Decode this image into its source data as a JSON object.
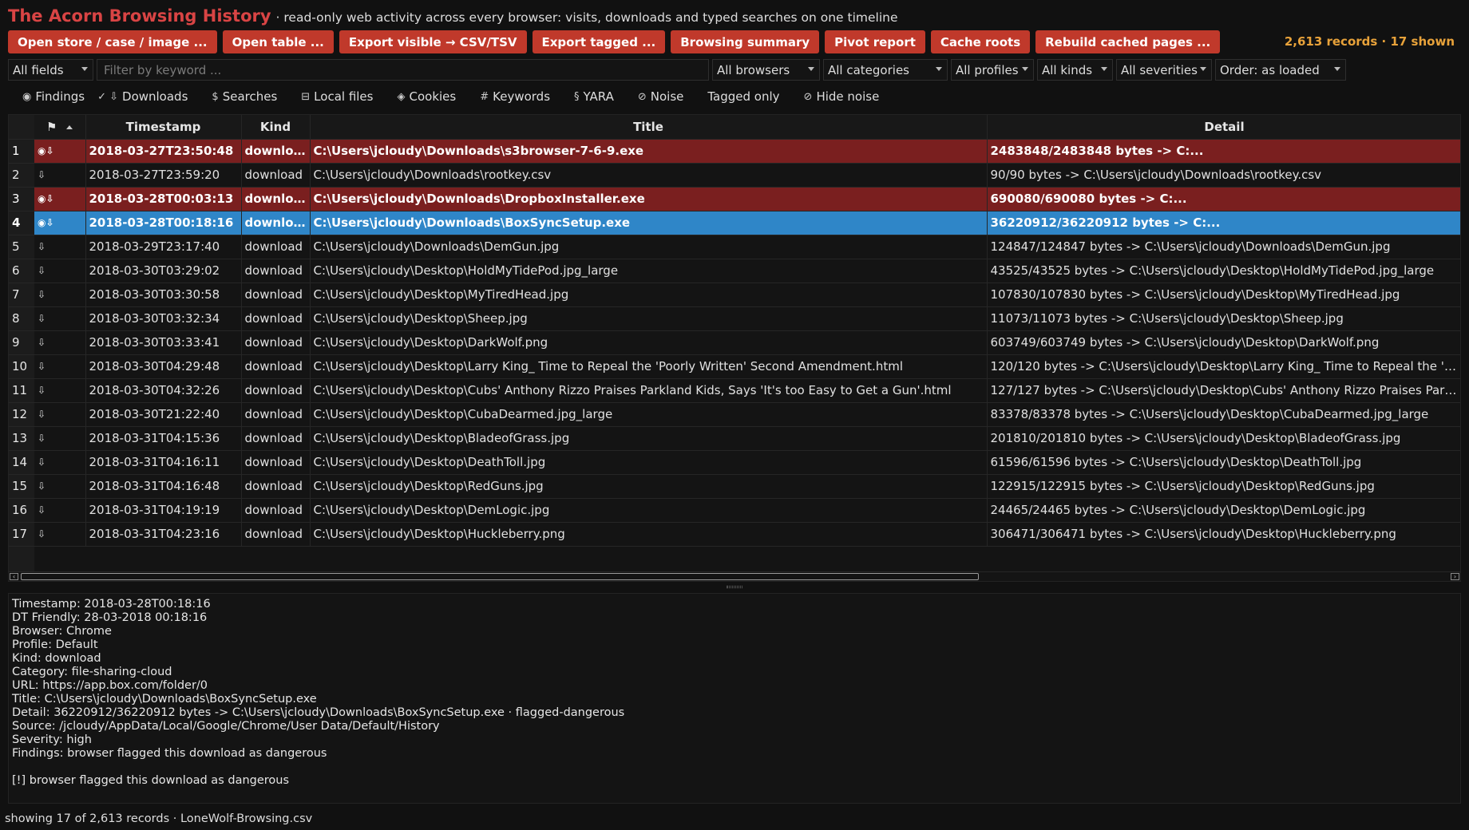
{
  "header": {
    "title": "The Acorn Browsing History",
    "subtitle": "· read-only web activity across every browser: visits, downloads and typed searches on one timeline"
  },
  "toolbar": {
    "buttons": [
      "Open store / case / image ...",
      "Open table ...",
      "Export visible → CSV/TSV",
      "Export tagged ...",
      "Browsing summary",
      "Pivot report",
      "Cache roots",
      "Rebuild cached pages ..."
    ],
    "counts": "2,613 records · 17 shown"
  },
  "filters": {
    "fields": "All fields",
    "keyword_placeholder": "Filter by keyword ...",
    "browsers": "All browsers",
    "categories": "All categories",
    "profiles": "All profiles",
    "kinds": "All kinds",
    "severities": "All severities",
    "order": "Order: as loaded"
  },
  "toggles": [
    {
      "icon": "◉",
      "label": "Findings"
    },
    {
      "icon": "✓ ⇩",
      "label": "Downloads"
    },
    {
      "icon": "$",
      "label": "Searches"
    },
    {
      "icon": "⊟",
      "label": "Local files"
    },
    {
      "icon": "◈",
      "label": "Cookies"
    },
    {
      "icon": "#",
      "label": "Keywords"
    },
    {
      "icon": "§",
      "label": "YARA"
    },
    {
      "icon": "⊘",
      "label": "Noise"
    },
    {
      "icon": "",
      "label": "Tagged only"
    },
    {
      "icon": "⊘",
      "label": "Hide noise"
    }
  ],
  "table": {
    "columns": {
      "flag": "⚑",
      "timestamp": "Timestamp",
      "kind": "Kind",
      "title": "Title",
      "detail": "Detail"
    },
    "rows": [
      {
        "num": "1",
        "flag": "◉⇩",
        "timestamp": "2018-03-27T23:50:48",
        "kind": "download",
        "title": "C:\\Users\\jcloudy\\Downloads\\s3browser-7-6-9.exe",
        "detail": "2483848/2483848 bytes -> C:...",
        "state": "danger"
      },
      {
        "num": "2",
        "flag": "⇩",
        "timestamp": "2018-03-27T23:59:20",
        "kind": "download",
        "title": "C:\\Users\\jcloudy\\Downloads\\rootkey.csv",
        "detail": "90/90 bytes -> C:\\Users\\jcloudy\\Downloads\\rootkey.csv",
        "state": ""
      },
      {
        "num": "3",
        "flag": "◉⇩",
        "timestamp": "2018-03-28T00:03:13",
        "kind": "download",
        "title": "C:\\Users\\jcloudy\\Downloads\\DropboxInstaller.exe",
        "detail": "690080/690080 bytes -> C:...",
        "state": "danger"
      },
      {
        "num": "4",
        "flag": "◉⇩",
        "timestamp": "2018-03-28T00:18:16",
        "kind": "download",
        "title": "C:\\Users\\jcloudy\\Downloads\\BoxSyncSetup.exe",
        "detail": "36220912/36220912 bytes -> C:...",
        "state": "selected"
      },
      {
        "num": "5",
        "flag": "⇩",
        "timestamp": "2018-03-29T23:17:40",
        "kind": "download",
        "title": "C:\\Users\\jcloudy\\Downloads\\DemGun.jpg",
        "detail": "124847/124847 bytes -> C:\\Users\\jcloudy\\Downloads\\DemGun.jpg",
        "state": ""
      },
      {
        "num": "6",
        "flag": "⇩",
        "timestamp": "2018-03-30T03:29:02",
        "kind": "download",
        "title": "C:\\Users\\jcloudy\\Desktop\\HoldMyTidePod.jpg_large",
        "detail": "43525/43525 bytes -> C:\\Users\\jcloudy\\Desktop\\HoldMyTidePod.jpg_large",
        "state": ""
      },
      {
        "num": "7",
        "flag": "⇩",
        "timestamp": "2018-03-30T03:30:58",
        "kind": "download",
        "title": "C:\\Users\\jcloudy\\Desktop\\MyTiredHead.jpg",
        "detail": "107830/107830 bytes -> C:\\Users\\jcloudy\\Desktop\\MyTiredHead.jpg",
        "state": ""
      },
      {
        "num": "8",
        "flag": "⇩",
        "timestamp": "2018-03-30T03:32:34",
        "kind": "download",
        "title": "C:\\Users\\jcloudy\\Desktop\\Sheep.jpg",
        "detail": "11073/11073 bytes -> C:\\Users\\jcloudy\\Desktop\\Sheep.jpg",
        "state": ""
      },
      {
        "num": "9",
        "flag": "⇩",
        "timestamp": "2018-03-30T03:33:41",
        "kind": "download",
        "title": "C:\\Users\\jcloudy\\Desktop\\DarkWolf.png",
        "detail": "603749/603749 bytes -> C:\\Users\\jcloudy\\Desktop\\DarkWolf.png",
        "state": ""
      },
      {
        "num": "10",
        "flag": "⇩",
        "timestamp": "2018-03-30T04:29:48",
        "kind": "download",
        "title": "C:\\Users\\jcloudy\\Desktop\\Larry King_ Time to Repeal the 'Poorly Written' Second Amendment.html",
        "detail": "120/120 bytes -> C:\\Users\\jcloudy\\Desktop\\Larry King_ Time to Repeal the 'Poorl...",
        "state": ""
      },
      {
        "num": "11",
        "flag": "⇩",
        "timestamp": "2018-03-30T04:32:26",
        "kind": "download",
        "title": "C:\\Users\\jcloudy\\Desktop\\Cubs' Anthony Rizzo Praises Parkland Kids, Says 'It's too Easy to Get a Gun'.html",
        "detail": "127/127 bytes -> C:\\Users\\jcloudy\\Desktop\\Cubs' Anthony Rizzo Praises Parkland...",
        "state": ""
      },
      {
        "num": "12",
        "flag": "⇩",
        "timestamp": "2018-03-30T21:22:40",
        "kind": "download",
        "title": "C:\\Users\\jcloudy\\Desktop\\CubaDearmed.jpg_large",
        "detail": "83378/83378 bytes -> C:\\Users\\jcloudy\\Desktop\\CubaDearmed.jpg_large",
        "state": ""
      },
      {
        "num": "13",
        "flag": "⇩",
        "timestamp": "2018-03-31T04:15:36",
        "kind": "download",
        "title": "C:\\Users\\jcloudy\\Desktop\\BladeofGrass.jpg",
        "detail": "201810/201810 bytes -> C:\\Users\\jcloudy\\Desktop\\BladeofGrass.jpg",
        "state": ""
      },
      {
        "num": "14",
        "flag": "⇩",
        "timestamp": "2018-03-31T04:16:11",
        "kind": "download",
        "title": "C:\\Users\\jcloudy\\Desktop\\DeathToll.jpg",
        "detail": "61596/61596 bytes -> C:\\Users\\jcloudy\\Desktop\\DeathToll.jpg",
        "state": ""
      },
      {
        "num": "15",
        "flag": "⇩",
        "timestamp": "2018-03-31T04:16:48",
        "kind": "download",
        "title": "C:\\Users\\jcloudy\\Desktop\\RedGuns.jpg",
        "detail": "122915/122915 bytes -> C:\\Users\\jcloudy\\Desktop\\RedGuns.jpg",
        "state": ""
      },
      {
        "num": "16",
        "flag": "⇩",
        "timestamp": "2018-03-31T04:19:19",
        "kind": "download",
        "title": "C:\\Users\\jcloudy\\Desktop\\DemLogic.jpg",
        "detail": "24465/24465 bytes -> C:\\Users\\jcloudy\\Desktop\\DemLogic.jpg",
        "state": ""
      },
      {
        "num": "17",
        "flag": "⇩",
        "timestamp": "2018-03-31T04:23:16",
        "kind": "download",
        "title": "C:\\Users\\jcloudy\\Desktop\\Huckleberry.png",
        "detail": "306471/306471 bytes -> C:\\Users\\jcloudy\\Desktop\\Huckleberry.png",
        "state": ""
      }
    ]
  },
  "detail": {
    "lines": [
      "Timestamp: 2018-03-28T00:18:16",
      "DT Friendly: 28-03-2018 00:18:16",
      "Browser: Chrome",
      "Profile: Default",
      "Kind: download",
      "Category: file-sharing-cloud",
      "URL: https://app.box.com/folder/0",
      "Title: C:\\Users\\jcloudy\\Downloads\\BoxSyncSetup.exe",
      "Detail: 36220912/36220912 bytes -> C:\\Users\\jcloudy\\Downloads\\BoxSyncSetup.exe · flagged-dangerous",
      "Source: /jcloudy/AppData/Local/Google/Chrome/User Data/Default/History",
      "Severity: high",
      "Findings: browser flagged this download as dangerous",
      "",
      "[!] browser flagged this download as dangerous"
    ]
  },
  "status": {
    "text": "showing 17 of 2,613 records  ·  LoneWolf-Browsing.csv"
  },
  "colors": {
    "accent": "#c0392b",
    "title": "#d94444",
    "danger_row": "#7a1f1f",
    "selected_row": "#2f86c8",
    "count_text": "#e8a23a"
  }
}
